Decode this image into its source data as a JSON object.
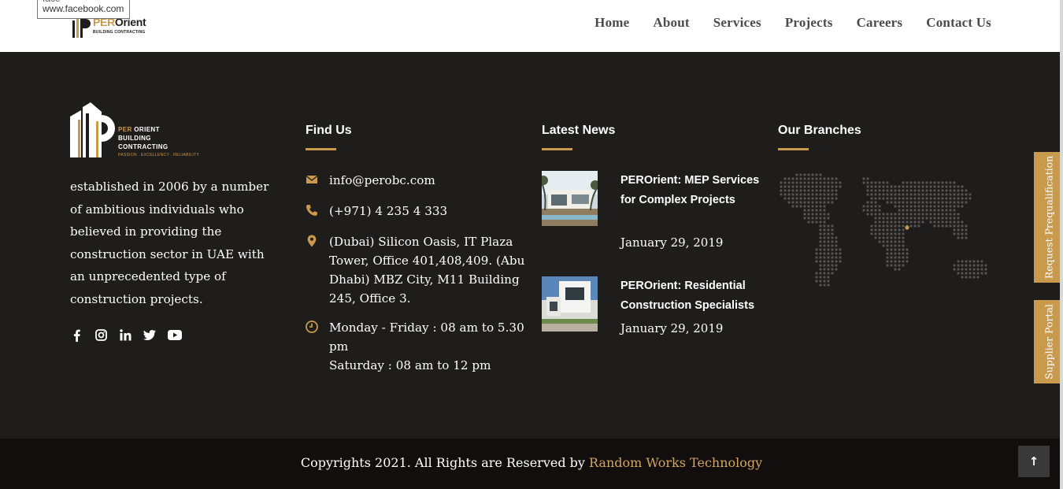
{
  "header": {
    "logo_name_accent": "PER",
    "logo_name": "Orient",
    "logo_sub": "BUILDING CONTRACTING",
    "tooltip_line1": "face",
    "tooltip_line2": "www.facebook.com",
    "nav": [
      "Home",
      "About",
      "Services",
      "Projects",
      "Careers",
      "Contact Us"
    ]
  },
  "footer": {
    "logo": {
      "line1_accent": "PER",
      "line1": " ORIENT",
      "line2": "BUILDING",
      "line3": "CONTRACTING",
      "tagline": "PASSION . EXCELLENCY . RELIABILITY"
    },
    "about_text": "established in 2006 by a number of ambitious individuals who believed in providing the construction sector in UAE with an unprecedented type of construction projects.",
    "social_icons": [
      "facebook-icon",
      "instagram-icon",
      "linkedin-icon",
      "twitter-icon",
      "youtube-icon"
    ],
    "find_us": {
      "heading": "Find Us",
      "email": "info@perobc.com",
      "phone": "(+971) 4 235 4 333",
      "address": "(Dubai) Silicon Oasis, IT Plaza Tower, Office 401,408,409. (Abu Dhabi) MBZ City, M11 Building 245, Office 3.",
      "hours_line1": "Monday - Friday : 08 am to 5.30 pm",
      "hours_line2": "Saturday : 08 am to 12 pm"
    },
    "latest_news": {
      "heading": "Latest News",
      "items": [
        {
          "title": "PEROrient: MEP Services for Complex Projects",
          "date": "January 29, 2019"
        },
        {
          "title": "PEROrient: Residential Construction Specialists",
          "date": "January 29, 2019"
        }
      ]
    },
    "branches": {
      "heading": "Our Branches"
    }
  },
  "side_tabs": [
    "Request Prequalification",
    "Supplier Portal"
  ],
  "bottom": {
    "copyright": "Copyrights 2021. All Rights are Reserved by ",
    "company_link": "Random Works Technology",
    "to_top": "↑"
  },
  "colors": {
    "accent": "#c99a4c",
    "background": "#1f1c1c",
    "bottom_bar": "#120e0e"
  }
}
